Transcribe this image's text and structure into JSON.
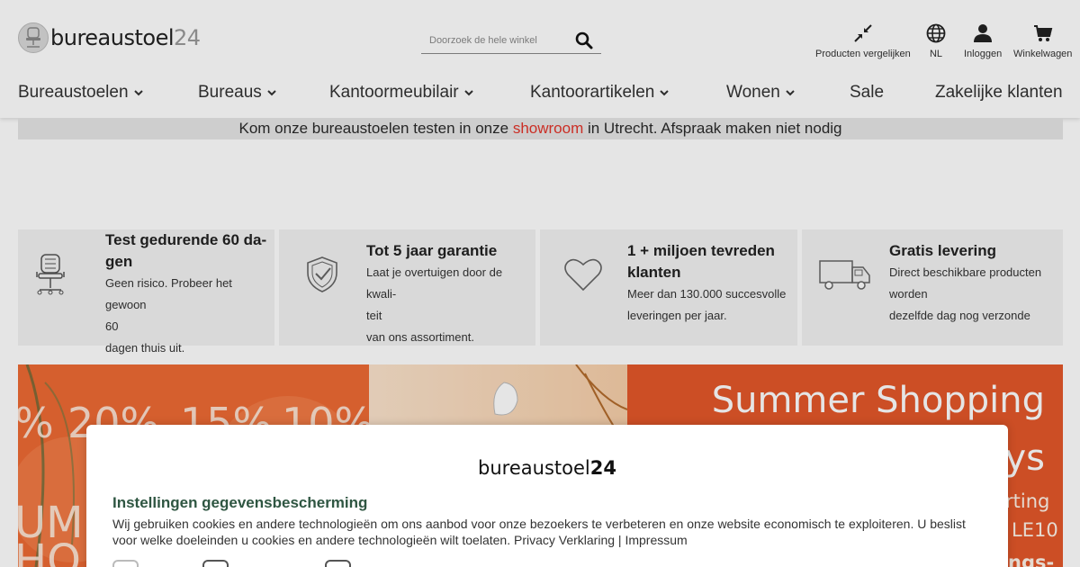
{
  "header": {
    "logo": {
      "text": "bureaustoel",
      "number": "24"
    },
    "search": {
      "placeholder": "Doorzoek de hele winkel"
    },
    "utilities": [
      {
        "label": "Producten vergelijken",
        "icon": "compare-arrows-icon"
      },
      {
        "label": "NL",
        "icon": "globe-icon"
      },
      {
        "label": "Inloggen",
        "icon": "user-icon"
      },
      {
        "label": "Winkelwagen",
        "icon": "cart-icon"
      }
    ],
    "nav": [
      {
        "label": "Bureaustoelen",
        "dropdown": true
      },
      {
        "label": "Bureaus",
        "dropdown": true
      },
      {
        "label": "Kantoormeubilair",
        "dropdown": true
      },
      {
        "label": "Kantoorartikelen",
        "dropdown": true
      },
      {
        "label": "Wonen",
        "dropdown": true
      },
      {
        "label": "Sale",
        "dropdown": false
      },
      {
        "label": "Zakelijke klanten",
        "dropdown": false
      }
    ]
  },
  "announcement": {
    "before": "Kom onze bureaustoelen testen in onze ",
    "link": "showroom",
    "after": " in Utrecht. Afspraak maken niet nodig"
  },
  "usps": [
    {
      "title_1": "Test gedurende 60 da-",
      "title_2": "gen",
      "desc_1": "Geen risico. Probeer het gewoon",
      "desc_2": "60",
      "desc_3": "dagen thuis uit.",
      "icon": "office-chair-icon"
    },
    {
      "title_1": "Tot 5 jaar garantie",
      "desc_1": "Laat je overtuigen door de kwali-",
      "desc_2": "teit",
      "desc_3": "van ons assortiment.",
      "icon": "shield-check-icon"
    },
    {
      "title_1": "1 + miljoen tevreden",
      "title_2": "klanten",
      "desc_1": "Meer dan 130.000 succesvolle",
      "desc_2": "leveringen per jaar.",
      "icon": "heart-icon"
    },
    {
      "title_1": "Gratis levering",
      "desc_1": "Direct beschikbare producten",
      "desc_2": "worden",
      "desc_3": "dezelfde dag nog verzonde",
      "icon": "delivery-truck-icon"
    }
  ],
  "banner": {
    "percentages": [
      "%",
      "20%",
      "15%",
      "10%"
    ],
    "headline_1": "Summer Shopping",
    "headline_2": "ys",
    "side_1": "rting",
    "side_2": "LE10",
    "side_3": "ngs-",
    "left_1": "UM",
    "left_2": "HO"
  },
  "cookie_modal": {
    "brand_text": "bureaustoel",
    "brand_number": "24",
    "title": "Instellingen gegevensbescherming",
    "text": "Wij gebruiken cookies en andere technologieën om ons aanbod voor onze bezoekers te verbeteren en onze website economisch te exploiteren. U beslist voor welke doeleinden u cookies en andere technologieën wilt toelaten.",
    "privacy_link": "Privacy Verklaring",
    "separator": "|",
    "impressum_link": "Impressum"
  },
  "colors": {
    "accent_red": "#e2342a",
    "modal_title_green": "#2f5642",
    "banner_orange": "#e85a2a"
  }
}
